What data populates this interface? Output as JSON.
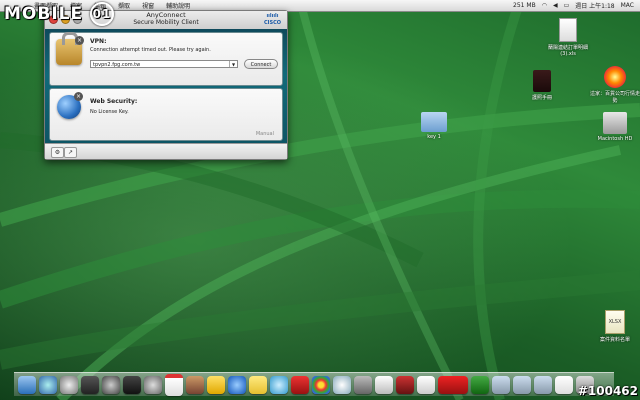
{
  "watermark": {
    "text": "MOBILE",
    "logo": "01"
  },
  "menubar": {
    "items": [
      "畫面擷取",
      "檔案",
      "編輯",
      "擷取",
      "視窗",
      "輔助說明"
    ],
    "status": {
      "memory": "251 MB",
      "datetime": "週日 上午1:18",
      "user": "MAC"
    }
  },
  "window": {
    "title": "AnyConnect",
    "subtitle": "Secure Mobility Client",
    "brand": "CISCO",
    "vpn": {
      "title": "VPN:",
      "message": "Connection attempt timed out. Please try again.",
      "address": "tpvpn2.fpg.com.tw",
      "connect_label": "Connect"
    },
    "security": {
      "title": "Web Security:",
      "message": "No License Key.",
      "mode": "Manual"
    }
  },
  "desktop": {
    "icons": [
      {
        "label": "蘭陽連結訂單明細 (3).xls"
      },
      {
        "label": "護照手冊"
      },
      {
        "label": "這家：百貨公司行情走勢"
      },
      {
        "label": "key 1"
      },
      {
        "label": "Macintosh HD"
      },
      {
        "label": "案件資料名單"
      }
    ],
    "xlsx_badge": "XLSX"
  },
  "colors": {
    "accent": "#116a7a",
    "brand": "#1a5aa8"
  },
  "image_id": "#100462"
}
